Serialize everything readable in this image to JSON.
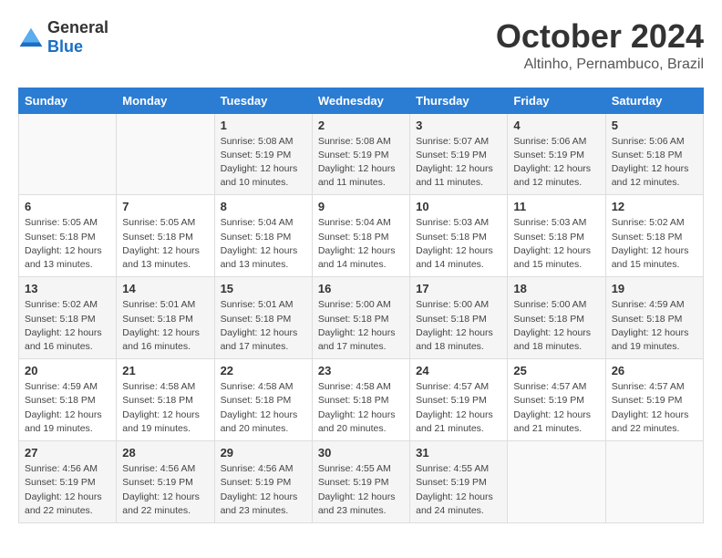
{
  "header": {
    "logo": {
      "general": "General",
      "blue": "Blue"
    },
    "title": "October 2024",
    "location": "Altinho, Pernambuco, Brazil"
  },
  "weekdays": [
    "Sunday",
    "Monday",
    "Tuesday",
    "Wednesday",
    "Thursday",
    "Friday",
    "Saturday"
  ],
  "weeks": [
    [
      {
        "day": "",
        "info": ""
      },
      {
        "day": "",
        "info": ""
      },
      {
        "day": "1",
        "info": "Sunrise: 5:08 AM\nSunset: 5:19 PM\nDaylight: 12 hours and 10 minutes."
      },
      {
        "day": "2",
        "info": "Sunrise: 5:08 AM\nSunset: 5:19 PM\nDaylight: 12 hours and 11 minutes."
      },
      {
        "day": "3",
        "info": "Sunrise: 5:07 AM\nSunset: 5:19 PM\nDaylight: 12 hours and 11 minutes."
      },
      {
        "day": "4",
        "info": "Sunrise: 5:06 AM\nSunset: 5:19 PM\nDaylight: 12 hours and 12 minutes."
      },
      {
        "day": "5",
        "info": "Sunrise: 5:06 AM\nSunset: 5:18 PM\nDaylight: 12 hours and 12 minutes."
      }
    ],
    [
      {
        "day": "6",
        "info": "Sunrise: 5:05 AM\nSunset: 5:18 PM\nDaylight: 12 hours and 13 minutes."
      },
      {
        "day": "7",
        "info": "Sunrise: 5:05 AM\nSunset: 5:18 PM\nDaylight: 12 hours and 13 minutes."
      },
      {
        "day": "8",
        "info": "Sunrise: 5:04 AM\nSunset: 5:18 PM\nDaylight: 12 hours and 13 minutes."
      },
      {
        "day": "9",
        "info": "Sunrise: 5:04 AM\nSunset: 5:18 PM\nDaylight: 12 hours and 14 minutes."
      },
      {
        "day": "10",
        "info": "Sunrise: 5:03 AM\nSunset: 5:18 PM\nDaylight: 12 hours and 14 minutes."
      },
      {
        "day": "11",
        "info": "Sunrise: 5:03 AM\nSunset: 5:18 PM\nDaylight: 12 hours and 15 minutes."
      },
      {
        "day": "12",
        "info": "Sunrise: 5:02 AM\nSunset: 5:18 PM\nDaylight: 12 hours and 15 minutes."
      }
    ],
    [
      {
        "day": "13",
        "info": "Sunrise: 5:02 AM\nSunset: 5:18 PM\nDaylight: 12 hours and 16 minutes."
      },
      {
        "day": "14",
        "info": "Sunrise: 5:01 AM\nSunset: 5:18 PM\nDaylight: 12 hours and 16 minutes."
      },
      {
        "day": "15",
        "info": "Sunrise: 5:01 AM\nSunset: 5:18 PM\nDaylight: 12 hours and 17 minutes."
      },
      {
        "day": "16",
        "info": "Sunrise: 5:00 AM\nSunset: 5:18 PM\nDaylight: 12 hours and 17 minutes."
      },
      {
        "day": "17",
        "info": "Sunrise: 5:00 AM\nSunset: 5:18 PM\nDaylight: 12 hours and 18 minutes."
      },
      {
        "day": "18",
        "info": "Sunrise: 5:00 AM\nSunset: 5:18 PM\nDaylight: 12 hours and 18 minutes."
      },
      {
        "day": "19",
        "info": "Sunrise: 4:59 AM\nSunset: 5:18 PM\nDaylight: 12 hours and 19 minutes."
      }
    ],
    [
      {
        "day": "20",
        "info": "Sunrise: 4:59 AM\nSunset: 5:18 PM\nDaylight: 12 hours and 19 minutes."
      },
      {
        "day": "21",
        "info": "Sunrise: 4:58 AM\nSunset: 5:18 PM\nDaylight: 12 hours and 19 minutes."
      },
      {
        "day": "22",
        "info": "Sunrise: 4:58 AM\nSunset: 5:18 PM\nDaylight: 12 hours and 20 minutes."
      },
      {
        "day": "23",
        "info": "Sunrise: 4:58 AM\nSunset: 5:18 PM\nDaylight: 12 hours and 20 minutes."
      },
      {
        "day": "24",
        "info": "Sunrise: 4:57 AM\nSunset: 5:19 PM\nDaylight: 12 hours and 21 minutes."
      },
      {
        "day": "25",
        "info": "Sunrise: 4:57 AM\nSunset: 5:19 PM\nDaylight: 12 hours and 21 minutes."
      },
      {
        "day": "26",
        "info": "Sunrise: 4:57 AM\nSunset: 5:19 PM\nDaylight: 12 hours and 22 minutes."
      }
    ],
    [
      {
        "day": "27",
        "info": "Sunrise: 4:56 AM\nSunset: 5:19 PM\nDaylight: 12 hours and 22 minutes."
      },
      {
        "day": "28",
        "info": "Sunrise: 4:56 AM\nSunset: 5:19 PM\nDaylight: 12 hours and 22 minutes."
      },
      {
        "day": "29",
        "info": "Sunrise: 4:56 AM\nSunset: 5:19 PM\nDaylight: 12 hours and 23 minutes."
      },
      {
        "day": "30",
        "info": "Sunrise: 4:55 AM\nSunset: 5:19 PM\nDaylight: 12 hours and 23 minutes."
      },
      {
        "day": "31",
        "info": "Sunrise: 4:55 AM\nSunset: 5:19 PM\nDaylight: 12 hours and 24 minutes."
      },
      {
        "day": "",
        "info": ""
      },
      {
        "day": "",
        "info": ""
      }
    ]
  ]
}
